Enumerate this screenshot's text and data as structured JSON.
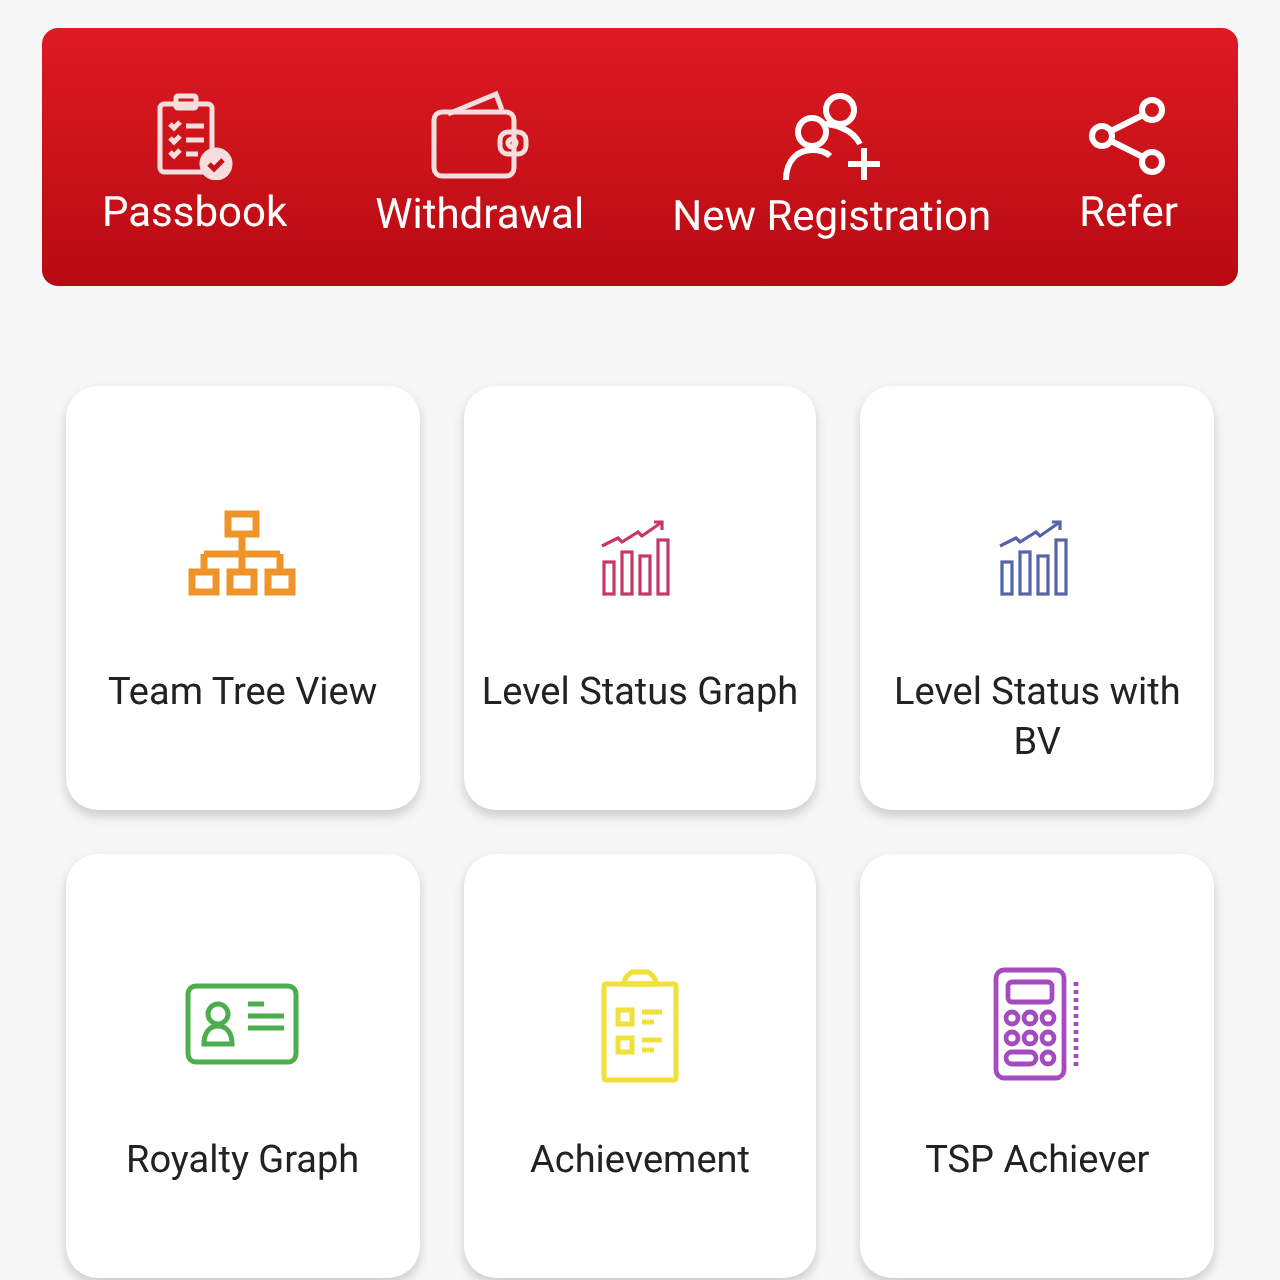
{
  "actions": [
    {
      "label": "Passbook"
    },
    {
      "label": "Withdrawal"
    },
    {
      "label": "New Registration"
    },
    {
      "label": "Refer"
    }
  ],
  "tiles": [
    {
      "label": "Team Tree View",
      "color": "#f0942a"
    },
    {
      "label": "Level Status Graph",
      "color": "#c8376a"
    },
    {
      "label": "Level Status with BV",
      "color": "#5563a8"
    },
    {
      "label": "Royalty Graph",
      "color": "#4cae4c"
    },
    {
      "label": "Achievement",
      "color": "#f2e03a"
    },
    {
      "label": "TSP Achiever",
      "color": "#a54bc0"
    }
  ]
}
